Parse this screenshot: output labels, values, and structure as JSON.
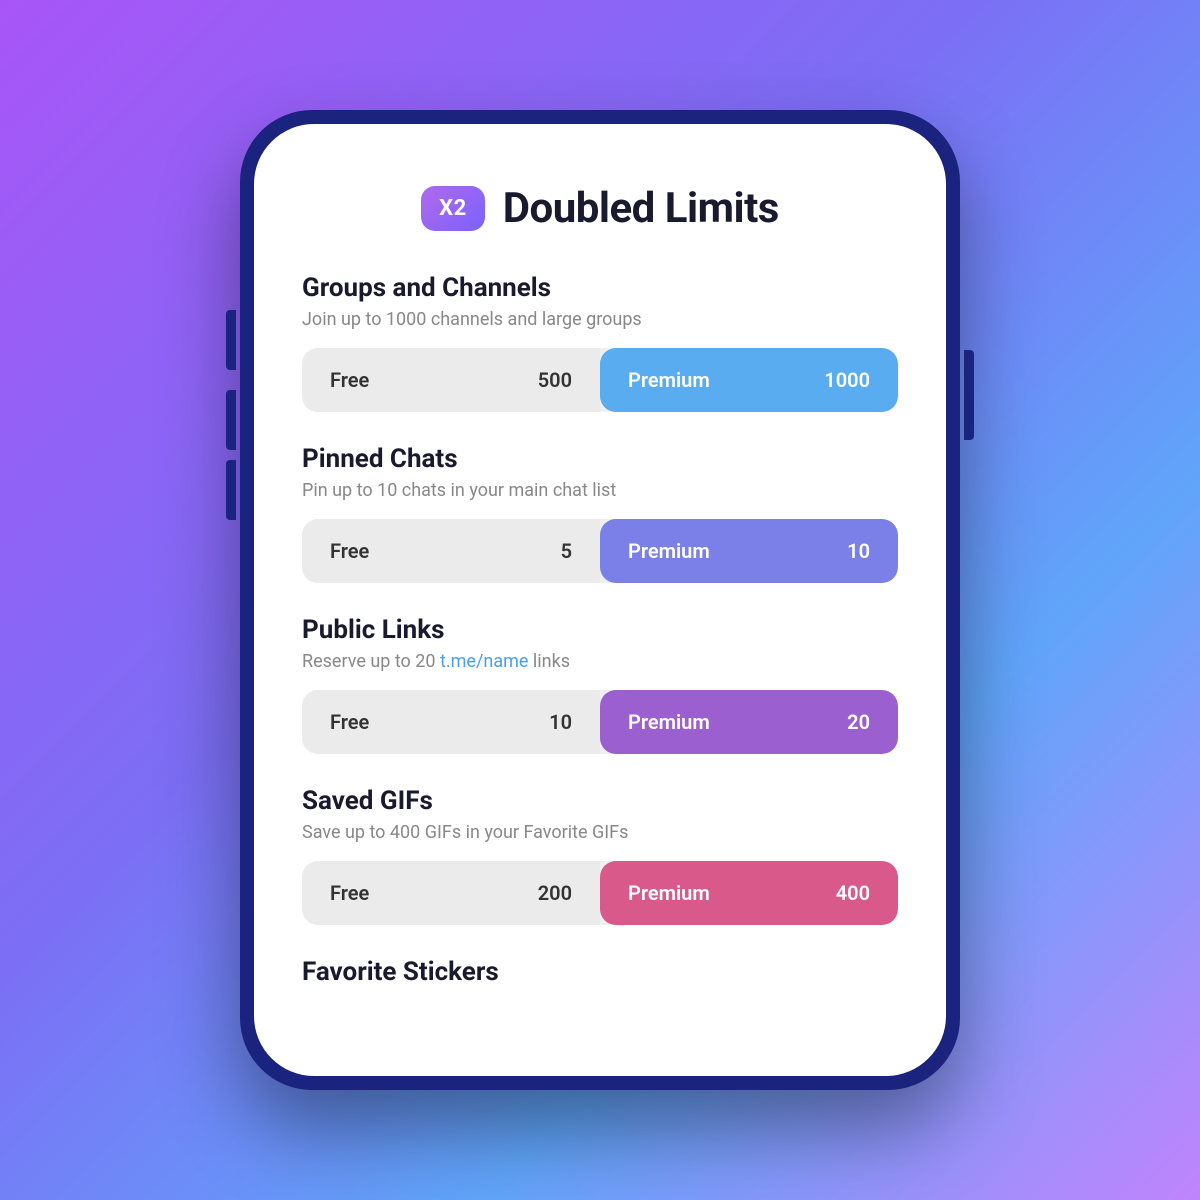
{
  "background": {
    "gradient_start": "#a855f7",
    "gradient_end": "#60a5fa"
  },
  "header": {
    "badge_label": "X2",
    "title": "Doubled Limits"
  },
  "features": [
    {
      "id": "groups-channels",
      "title": "Groups and Channels",
      "description": "Join up to 1000 channels and large groups",
      "description_link": null,
      "free_label": "Free",
      "free_value": "500",
      "premium_label": "Premium",
      "premium_value": "1000",
      "premium_color_class": "premium-blue"
    },
    {
      "id": "pinned-chats",
      "title": "Pinned Chats",
      "description": "Pin up to 10 chats in your main chat list",
      "description_link": null,
      "free_label": "Free",
      "free_value": "5",
      "premium_label": "Premium",
      "premium_value": "10",
      "premium_color_class": "premium-purple"
    },
    {
      "id": "public-links",
      "title": "Public Links",
      "description_before": "Reserve up to 20 ",
      "description_link_text": "t.me/name",
      "description_after": " links",
      "free_label": "Free",
      "free_value": "10",
      "premium_label": "Premium",
      "premium_value": "20",
      "premium_color_class": "premium-violet"
    },
    {
      "id": "saved-gifs",
      "title": "Saved GIFs",
      "description": "Save up to 400 GIFs in your Favorite GIFs",
      "description_link": null,
      "free_label": "Free",
      "free_value": "200",
      "premium_label": "Premium",
      "premium_value": "400",
      "premium_color_class": "premium-pink"
    }
  ],
  "bottom_section": {
    "title": "Favorite Stickers"
  }
}
